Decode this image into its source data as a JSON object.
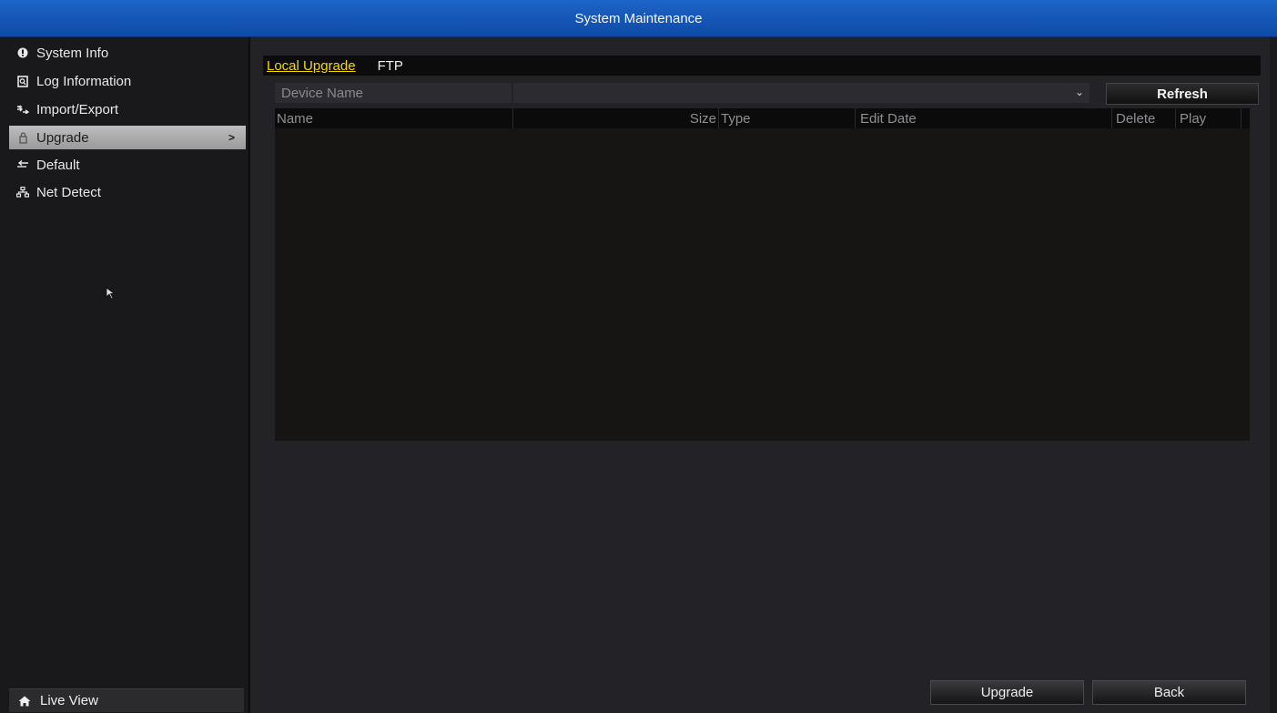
{
  "window": {
    "title": "System Maintenance"
  },
  "sidebar": {
    "items": [
      {
        "label": "System Info",
        "icon": "info-icon",
        "active": false
      },
      {
        "label": "Log Information",
        "icon": "log-icon",
        "active": false
      },
      {
        "label": "Import/Export",
        "icon": "import-export-icon",
        "active": false
      },
      {
        "label": "Upgrade",
        "icon": "upgrade-icon",
        "active": true
      },
      {
        "label": "Default",
        "icon": "default-icon",
        "active": false
      },
      {
        "label": "Net Detect",
        "icon": "network-icon",
        "active": false
      }
    ],
    "live_view": {
      "label": "Live View",
      "icon": "home-icon"
    }
  },
  "main": {
    "tabs": [
      {
        "label": "Local Upgrade",
        "active": true
      },
      {
        "label": "FTP",
        "active": false
      }
    ],
    "device": {
      "label": "Device Name",
      "value": "",
      "refresh_label": "Refresh"
    },
    "table": {
      "columns": [
        "Name",
        "Size",
        "Type",
        "Edit Date",
        "Delete",
        "Play"
      ],
      "rows": []
    },
    "buttons": {
      "upgrade_label": "Upgrade",
      "back_label": "Back"
    }
  },
  "colors": {
    "title_bar": "#1d64c8",
    "active_tab": "#f4d80a",
    "active_side_item": "#bdbdbd"
  }
}
